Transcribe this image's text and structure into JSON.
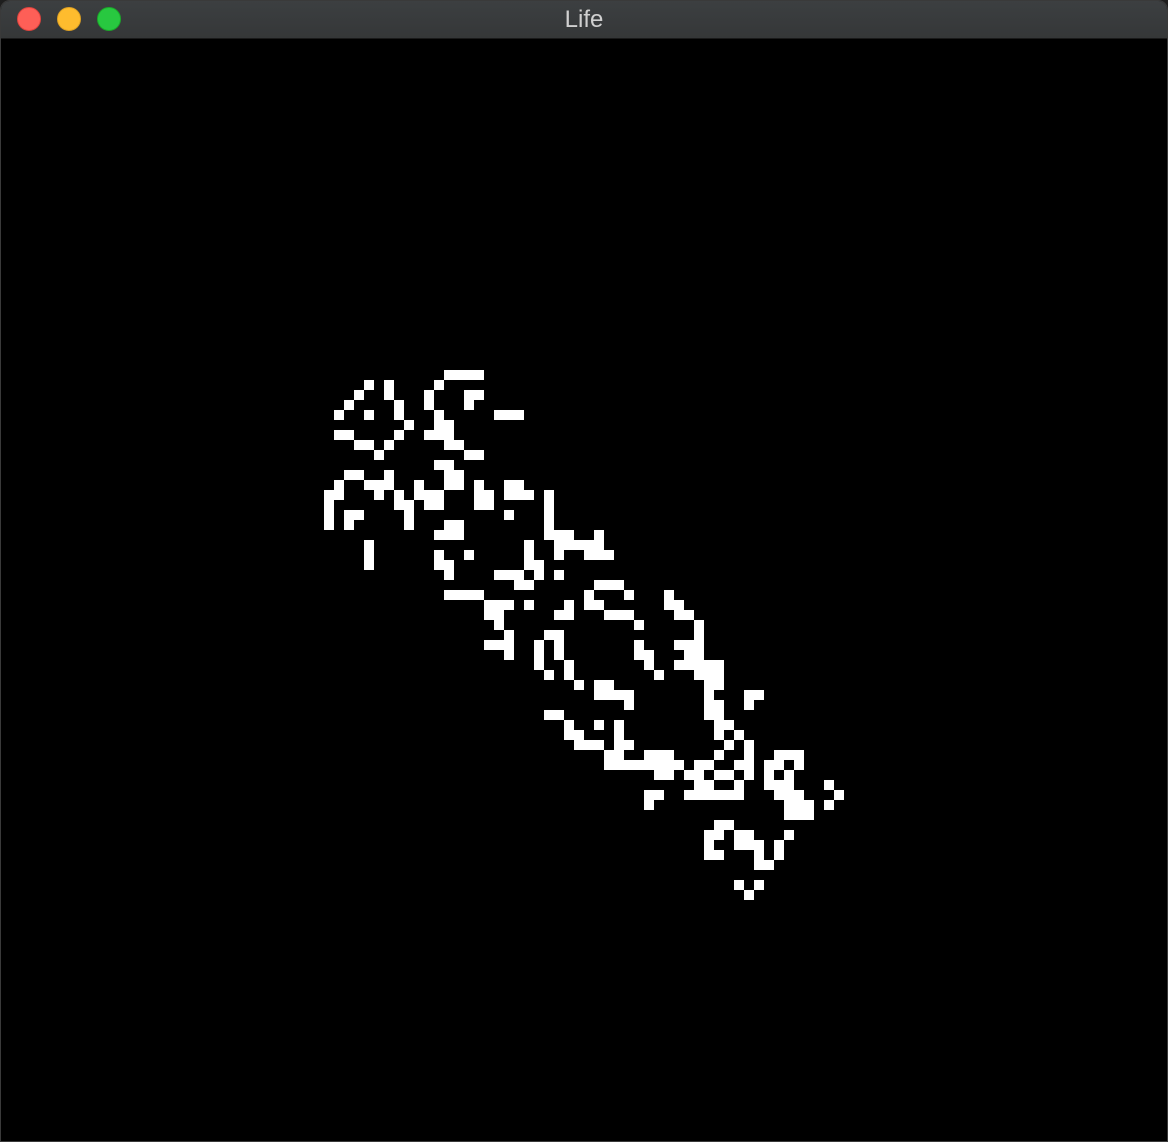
{
  "window": {
    "title": "Life"
  },
  "icons": {
    "close": "close-icon",
    "minimize": "minimize-icon",
    "zoom": "zoom-icon"
  },
  "colors": {
    "background": "#000000",
    "live_cell": "#ffffff",
    "close": "#fe5f57",
    "minimize": "#febc2e",
    "zoom": "#28c840"
  },
  "grid": {
    "live_cells": [
      [
        44,
        36
      ],
      [
        45,
        36
      ],
      [
        46,
        36
      ],
      [
        47,
        36
      ],
      [
        36,
        37
      ],
      [
        38,
        37
      ],
      [
        43,
        37
      ],
      [
        35,
        38
      ],
      [
        38,
        38
      ],
      [
        42,
        38
      ],
      [
        46,
        38
      ],
      [
        47,
        38
      ],
      [
        34,
        39
      ],
      [
        39,
        39
      ],
      [
        42,
        39
      ],
      [
        46,
        39
      ],
      [
        33,
        40
      ],
      [
        36,
        40
      ],
      [
        39,
        40
      ],
      [
        43,
        40
      ],
      [
        49,
        40
      ],
      [
        50,
        40
      ],
      [
        51,
        40
      ],
      [
        40,
        41
      ],
      [
        43,
        41
      ],
      [
        44,
        41
      ],
      [
        33,
        42
      ],
      [
        34,
        42
      ],
      [
        39,
        42
      ],
      [
        42,
        42
      ],
      [
        43,
        42
      ],
      [
        44,
        42
      ],
      [
        35,
        43
      ],
      [
        36,
        43
      ],
      [
        38,
        43
      ],
      [
        44,
        43
      ],
      [
        45,
        43
      ],
      [
        37,
        44
      ],
      [
        46,
        44
      ],
      [
        47,
        44
      ],
      [
        43,
        45
      ],
      [
        44,
        45
      ],
      [
        34,
        46
      ],
      [
        35,
        46
      ],
      [
        38,
        46
      ],
      [
        44,
        46
      ],
      [
        45,
        46
      ],
      [
        33,
        47
      ],
      [
        36,
        47
      ],
      [
        37,
        47
      ],
      [
        38,
        47
      ],
      [
        41,
        47
      ],
      [
        44,
        47
      ],
      [
        45,
        47
      ],
      [
        47,
        47
      ],
      [
        50,
        47
      ],
      [
        51,
        47
      ],
      [
        32,
        48
      ],
      [
        33,
        48
      ],
      [
        37,
        48
      ],
      [
        39,
        48
      ],
      [
        41,
        48
      ],
      [
        42,
        48
      ],
      [
        43,
        48
      ],
      [
        47,
        48
      ],
      [
        48,
        48
      ],
      [
        50,
        48
      ],
      [
        51,
        48
      ],
      [
        52,
        48
      ],
      [
        54,
        48
      ],
      [
        32,
        49
      ],
      [
        39,
        49
      ],
      [
        40,
        49
      ],
      [
        42,
        49
      ],
      [
        43,
        49
      ],
      [
        47,
        49
      ],
      [
        48,
        49
      ],
      [
        54,
        49
      ],
      [
        32,
        50
      ],
      [
        34,
        50
      ],
      [
        35,
        50
      ],
      [
        40,
        50
      ],
      [
        50,
        50
      ],
      [
        54,
        50
      ],
      [
        32,
        51
      ],
      [
        34,
        51
      ],
      [
        40,
        51
      ],
      [
        44,
        51
      ],
      [
        45,
        51
      ],
      [
        54,
        51
      ],
      [
        43,
        52
      ],
      [
        44,
        52
      ],
      [
        45,
        52
      ],
      [
        54,
        52
      ],
      [
        55,
        52
      ],
      [
        56,
        52
      ],
      [
        59,
        52
      ],
      [
        36,
        53
      ],
      [
        52,
        53
      ],
      [
        55,
        53
      ],
      [
        56,
        53
      ],
      [
        57,
        53
      ],
      [
        58,
        53
      ],
      [
        59,
        53
      ],
      [
        36,
        54
      ],
      [
        43,
        54
      ],
      [
        46,
        54
      ],
      [
        52,
        54
      ],
      [
        55,
        54
      ],
      [
        58,
        54
      ],
      [
        59,
        54
      ],
      [
        60,
        54
      ],
      [
        36,
        55
      ],
      [
        43,
        55
      ],
      [
        44,
        55
      ],
      [
        52,
        55
      ],
      [
        53,
        55
      ],
      [
        44,
        56
      ],
      [
        49,
        56
      ],
      [
        50,
        56
      ],
      [
        51,
        56
      ],
      [
        53,
        56
      ],
      [
        55,
        56
      ],
      [
        51,
        57
      ],
      [
        52,
        57
      ],
      [
        59,
        57
      ],
      [
        60,
        57
      ],
      [
        61,
        57
      ],
      [
        44,
        58
      ],
      [
        45,
        58
      ],
      [
        46,
        58
      ],
      [
        47,
        58
      ],
      [
        58,
        58
      ],
      [
        62,
        58
      ],
      [
        66,
        58
      ],
      [
        48,
        59
      ],
      [
        49,
        59
      ],
      [
        50,
        59
      ],
      [
        52,
        59
      ],
      [
        56,
        59
      ],
      [
        58,
        59
      ],
      [
        59,
        59
      ],
      [
        66,
        59
      ],
      [
        67,
        59
      ],
      [
        48,
        60
      ],
      [
        49,
        60
      ],
      [
        55,
        60
      ],
      [
        56,
        60
      ],
      [
        60,
        60
      ],
      [
        61,
        60
      ],
      [
        62,
        60
      ],
      [
        67,
        60
      ],
      [
        68,
        60
      ],
      [
        49,
        61
      ],
      [
        63,
        61
      ],
      [
        69,
        61
      ],
      [
        50,
        62
      ],
      [
        54,
        62
      ],
      [
        55,
        62
      ],
      [
        69,
        62
      ],
      [
        48,
        63
      ],
      [
        49,
        63
      ],
      [
        50,
        63
      ],
      [
        53,
        63
      ],
      [
        55,
        63
      ],
      [
        63,
        63
      ],
      [
        67,
        63
      ],
      [
        68,
        63
      ],
      [
        69,
        63
      ],
      [
        50,
        64
      ],
      [
        53,
        64
      ],
      [
        55,
        64
      ],
      [
        63,
        64
      ],
      [
        64,
        64
      ],
      [
        68,
        64
      ],
      [
        69,
        64
      ],
      [
        53,
        65
      ],
      [
        56,
        65
      ],
      [
        64,
        65
      ],
      [
        67,
        65
      ],
      [
        68,
        65
      ],
      [
        69,
        65
      ],
      [
        70,
        65
      ],
      [
        71,
        65
      ],
      [
        54,
        66
      ],
      [
        56,
        66
      ],
      [
        65,
        66
      ],
      [
        69,
        66
      ],
      [
        70,
        66
      ],
      [
        71,
        66
      ],
      [
        57,
        67
      ],
      [
        59,
        67
      ],
      [
        60,
        67
      ],
      [
        70,
        67
      ],
      [
        71,
        67
      ],
      [
        59,
        68
      ],
      [
        60,
        68
      ],
      [
        61,
        68
      ],
      [
        62,
        68
      ],
      [
        70,
        68
      ],
      [
        74,
        68
      ],
      [
        75,
        68
      ],
      [
        62,
        69
      ],
      [
        70,
        69
      ],
      [
        71,
        69
      ],
      [
        74,
        69
      ],
      [
        54,
        70
      ],
      [
        55,
        70
      ],
      [
        70,
        70
      ],
      [
        71,
        70
      ],
      [
        56,
        71
      ],
      [
        59,
        71
      ],
      [
        61,
        71
      ],
      [
        71,
        71
      ],
      [
        72,
        71
      ],
      [
        56,
        72
      ],
      [
        57,
        72
      ],
      [
        61,
        72
      ],
      [
        71,
        72
      ],
      [
        73,
        72
      ],
      [
        57,
        73
      ],
      [
        58,
        73
      ],
      [
        59,
        73
      ],
      [
        61,
        73
      ],
      [
        62,
        73
      ],
      [
        72,
        73
      ],
      [
        74,
        73
      ],
      [
        60,
        74
      ],
      [
        61,
        74
      ],
      [
        64,
        74
      ],
      [
        65,
        74
      ],
      [
        66,
        74
      ],
      [
        71,
        74
      ],
      [
        74,
        74
      ],
      [
        77,
        74
      ],
      [
        78,
        74
      ],
      [
        79,
        74
      ],
      [
        60,
        75
      ],
      [
        61,
        75
      ],
      [
        62,
        75
      ],
      [
        63,
        75
      ],
      [
        64,
        75
      ],
      [
        65,
        75
      ],
      [
        66,
        75
      ],
      [
        67,
        75
      ],
      [
        69,
        75
      ],
      [
        70,
        75
      ],
      [
        73,
        75
      ],
      [
        74,
        75
      ],
      [
        76,
        75
      ],
      [
        77,
        75
      ],
      [
        79,
        75
      ],
      [
        65,
        76
      ],
      [
        66,
        76
      ],
      [
        68,
        76
      ],
      [
        69,
        76
      ],
      [
        71,
        76
      ],
      [
        72,
        76
      ],
      [
        74,
        76
      ],
      [
        76,
        76
      ],
      [
        78,
        76
      ],
      [
        69,
        77
      ],
      [
        70,
        77
      ],
      [
        73,
        77
      ],
      [
        76,
        77
      ],
      [
        77,
        77
      ],
      [
        78,
        77
      ],
      [
        82,
        77
      ],
      [
        64,
        78
      ],
      [
        65,
        78
      ],
      [
        68,
        78
      ],
      [
        69,
        78
      ],
      [
        70,
        78
      ],
      [
        71,
        78
      ],
      [
        72,
        78
      ],
      [
        73,
        78
      ],
      [
        77,
        78
      ],
      [
        78,
        78
      ],
      [
        79,
        78
      ],
      [
        83,
        78
      ],
      [
        64,
        79
      ],
      [
        78,
        79
      ],
      [
        79,
        79
      ],
      [
        80,
        79
      ],
      [
        82,
        79
      ],
      [
        78,
        80
      ],
      [
        79,
        80
      ],
      [
        80,
        80
      ],
      [
        71,
        81
      ],
      [
        72,
        81
      ],
      [
        70,
        82
      ],
      [
        71,
        82
      ],
      [
        73,
        82
      ],
      [
        74,
        82
      ],
      [
        78,
        82
      ],
      [
        70,
        83
      ],
      [
        73,
        83
      ],
      [
        74,
        83
      ],
      [
        75,
        83
      ],
      [
        77,
        83
      ],
      [
        70,
        84
      ],
      [
        71,
        84
      ],
      [
        75,
        84
      ],
      [
        77,
        84
      ],
      [
        75,
        85
      ],
      [
        76,
        85
      ],
      [
        73,
        87
      ],
      [
        75,
        87
      ],
      [
        74,
        88
      ]
    ]
  }
}
